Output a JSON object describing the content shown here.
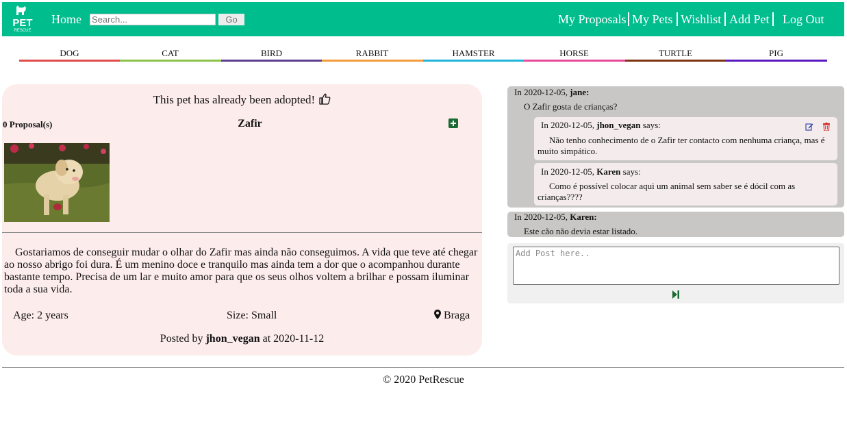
{
  "header": {
    "logo": {
      "line1": "PET",
      "line2": "RESCUE",
      "icon": "dog-cat-silhouette-icon"
    },
    "home_label": "Home",
    "search": {
      "placeholder": "Search...",
      "value": ""
    },
    "go_label": "Go",
    "nav": {
      "my_proposals": "My Proposals",
      "my_pets": "My Pets",
      "wishlist": "Wishlist",
      "add_pet": "Add Pet",
      "log_out": "Log Out"
    },
    "bg_color": "#00bd8e"
  },
  "categories": [
    {
      "label": "DOG",
      "color": "#e04a4a"
    },
    {
      "label": "CAT",
      "color": "#8bc34a"
    },
    {
      "label": "BIRD",
      "color": "#5c3d8f"
    },
    {
      "label": "RABBIT",
      "color": "#f59a3b"
    },
    {
      "label": "HAMSTER",
      "color": "#1fb4d8"
    },
    {
      "label": "HORSE",
      "color": "#e8489a"
    },
    {
      "label": "TURTLE",
      "color": "#7b3410"
    },
    {
      "label": "PIG",
      "color": "#5a17c0"
    }
  ],
  "pet": {
    "adopted_message": "This pet has already been adopted!",
    "proposals": "0 Proposal(s)",
    "name": "Zafir",
    "description": "Gostariamos de conseguir mudar o olhar do Zafir mas ainda não conseguimos. A vida que teve até chegar ao nosso abrigo foi dura. É um menino doce e tranquilo mas ainda tem a dor que o acompanhou durante bastante tempo. Precisa de um lar e muito amor para que os seus olhos voltem a brilhar e possam iluminar toda a sua vida.",
    "age": "Age: 2 years",
    "size": "Size: Small",
    "location": "Braga",
    "posted_prefix": "Posted by",
    "posted_by": "jhon_vegan",
    "posted_suffix": "at 2020-11-12"
  },
  "comments": [
    {
      "prefix": "In 2020-12-05,",
      "author": "jane:",
      "text": "O Zafir gosta de crianças?",
      "replies": [
        {
          "prefix": "In 2020-12-05,",
          "author": "jhon_vegan",
          "says": "says:",
          "text": "Não tenho conhecimento de o Zafir ter contacto com nenhuma criança, mas é muito simpático."
        },
        {
          "prefix": "In 2020-12-05,",
          "author": "Karen",
          "says": "says:",
          "text": "Como é possível colocar aqui um animal sem saber se é dócil com as crianças????"
        }
      ]
    },
    {
      "prefix": "In 2020-12-05,",
      "author": "Karen:",
      "text": "Este cão não devia estar listado.",
      "replies": []
    }
  ],
  "post": {
    "placeholder": "Add Post here..",
    "value": ""
  },
  "footer": {
    "text": "© 2020 PetRescue"
  }
}
